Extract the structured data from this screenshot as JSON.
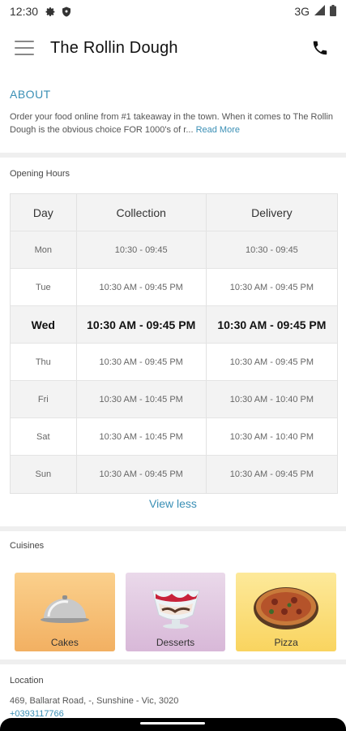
{
  "status_bar": {
    "time": "12:30",
    "network": "3G"
  },
  "app_bar": {
    "title": "The Rollin Dough"
  },
  "about": {
    "title": "ABOUT",
    "text": "Order your food online from #1 takeaway in the town. When it comes to The Rollin Dough is the obvious choice FOR 1000's of r...",
    "read_more": "Read More"
  },
  "opening_hours": {
    "title": "Opening Hours",
    "headers": {
      "day": "Day",
      "collection": "Collection",
      "delivery": "Delivery"
    },
    "rows": [
      {
        "day": "Mon",
        "collection": "10:30       - 09:45",
        "delivery": "10:30       - 09:45"
      },
      {
        "day": "Tue",
        "collection": "10:30 AM - 09:45 PM",
        "delivery": "10:30 AM - 09:45 PM"
      },
      {
        "day": "Wed",
        "collection": "10:30 AM - 09:45 PM",
        "delivery": "10:30 AM - 09:45 PM"
      },
      {
        "day": "Thu",
        "collection": "10:30 AM - 09:45 PM",
        "delivery": "10:30 AM - 09:45 PM"
      },
      {
        "day": "Fri",
        "collection": "10:30 AM - 10:45 PM",
        "delivery": "10:30 AM - 10:40 PM"
      },
      {
        "day": "Sat",
        "collection": "10:30 AM - 10:45 PM",
        "delivery": "10:30 AM - 10:40 PM"
      },
      {
        "day": "Sun",
        "collection": "10:30 AM - 09:45 PM",
        "delivery": "10:30 AM - 09:45 PM"
      }
    ],
    "view_less": "View less"
  },
  "cuisines": {
    "title": "Cuisines",
    "items": [
      {
        "label": "Cakes",
        "icon": "cloche-icon"
      },
      {
        "label": "Desserts",
        "icon": "dessert-bowl-icon"
      },
      {
        "label": "Pizza",
        "icon": "pizza-icon"
      }
    ]
  },
  "location": {
    "title": "Location",
    "address": "469, Ballarat Road, -, Sunshine - Vic, 3020",
    "phone": "+0393117766"
  },
  "colors": {
    "accent": "#3a8fb5",
    "divider": "#efefef",
    "row_shade": "#f3f3f3"
  }
}
